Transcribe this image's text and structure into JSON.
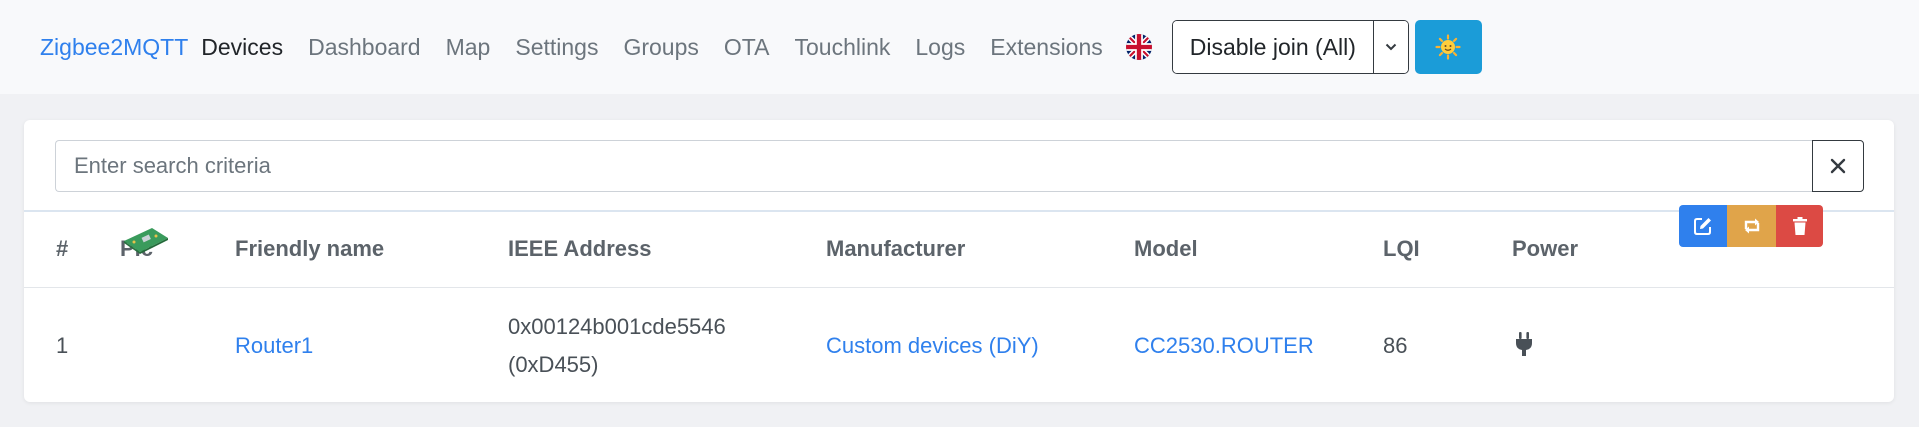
{
  "nav": {
    "brand": "Zigbee2MQTT",
    "links": [
      "Devices",
      "Dashboard",
      "Map",
      "Settings",
      "Groups",
      "OTA",
      "Touchlink",
      "Logs",
      "Extensions"
    ],
    "active": "Devices",
    "language_flag": "uk-flag-icon",
    "join_button": "Disable join (All)",
    "theme_icon": "sun-icon"
  },
  "search": {
    "placeholder": "Enter search criteria",
    "value": ""
  },
  "table": {
    "columns": [
      "#",
      "Pic",
      "Friendly name",
      "IEEE Address",
      "Manufacturer",
      "Model",
      "LQI",
      "Power"
    ],
    "rows": [
      {
        "index": "1",
        "pic_icon": "device-board-icon",
        "friendly_name": "Router1",
        "ieee_address": "0x00124b001cde5546",
        "network_address": "(0xD455)",
        "manufacturer": "Custom devices (DiY)",
        "model": "CC2530.ROUTER",
        "lqi": "86",
        "power_icon": "plug-icon",
        "actions": [
          "edit-icon",
          "swap-icon",
          "trash-icon"
        ]
      }
    ]
  },
  "colors": {
    "link": "#2f80ed",
    "theme_button": "#1b9cd8",
    "edit": "#2f80ed",
    "swap": "#e0a44a",
    "delete": "#dc4a44"
  }
}
